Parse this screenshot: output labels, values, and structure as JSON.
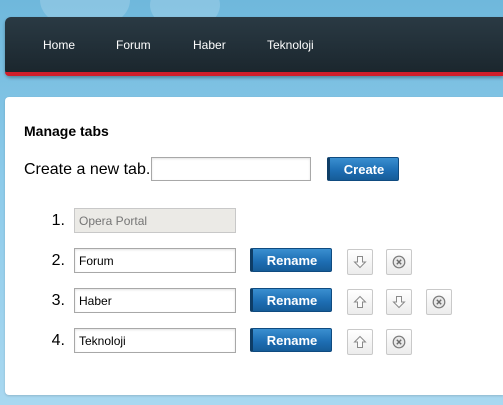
{
  "nav": {
    "items": [
      {
        "label": "Home"
      },
      {
        "label": "Forum"
      },
      {
        "label": "Haber"
      },
      {
        "label": "Teknoloji"
      }
    ]
  },
  "manage": {
    "title": "Manage tabs",
    "create_label": "Create a new tab.",
    "create_input_value": "",
    "create_button": "Create",
    "rename_label": "Rename",
    "tabs": [
      {
        "number": "1.",
        "value": "Opera Portal",
        "disabled": true
      },
      {
        "number": "2.",
        "value": "Forum"
      },
      {
        "number": "3.",
        "value": "Haber"
      },
      {
        "number": "4.",
        "value": "Teknoloji"
      }
    ]
  },
  "colors": {
    "nav_bg": "#1f2b32",
    "nav_accent": "#d01e2a",
    "button_blue": "#1e6fb4"
  },
  "icons": {
    "move_up": "arrow-up-icon",
    "move_down": "arrow-down-icon",
    "delete": "close-circle-icon"
  }
}
